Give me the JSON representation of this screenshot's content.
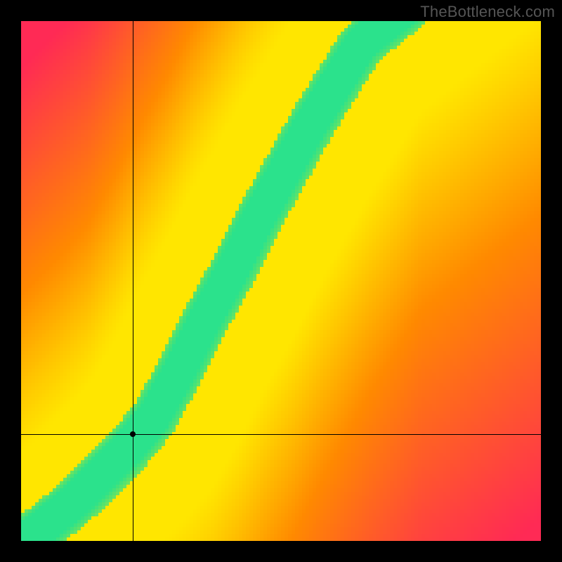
{
  "watermark": "TheBottleneck.com",
  "chart_data": {
    "type": "heatmap",
    "title": "",
    "xlabel": "",
    "ylabel": "",
    "grid_size": 148,
    "colors": {
      "low": "#ff2a55",
      "mid_low": "#ff8a00",
      "mid": "#ffe600",
      "optimal": "#2be28c",
      "background": "#000000"
    },
    "marker": {
      "x_frac": 0.215,
      "y_frac": 0.205
    },
    "crosshair": {
      "x_frac": 0.215,
      "y_frac": 0.205
    },
    "optimal_curve": {
      "description": "Green optimal band: GPU demand as a function of CPU, superlinear after knee ~0.25, near-linear below.",
      "samples": [
        {
          "x": 0.0,
          "y": 0.0
        },
        {
          "x": 0.05,
          "y": 0.04
        },
        {
          "x": 0.1,
          "y": 0.08
        },
        {
          "x": 0.15,
          "y": 0.13
        },
        {
          "x": 0.2,
          "y": 0.18
        },
        {
          "x": 0.25,
          "y": 0.24
        },
        {
          "x": 0.3,
          "y": 0.33
        },
        {
          "x": 0.35,
          "y": 0.43
        },
        {
          "x": 0.4,
          "y": 0.52
        },
        {
          "x": 0.45,
          "y": 0.62
        },
        {
          "x": 0.5,
          "y": 0.71
        },
        {
          "x": 0.55,
          "y": 0.8
        },
        {
          "x": 0.6,
          "y": 0.88
        },
        {
          "x": 0.65,
          "y": 0.96
        },
        {
          "x": 0.7,
          "y": 1.0
        }
      ],
      "band_halfwidth_frac": 0.045
    }
  }
}
